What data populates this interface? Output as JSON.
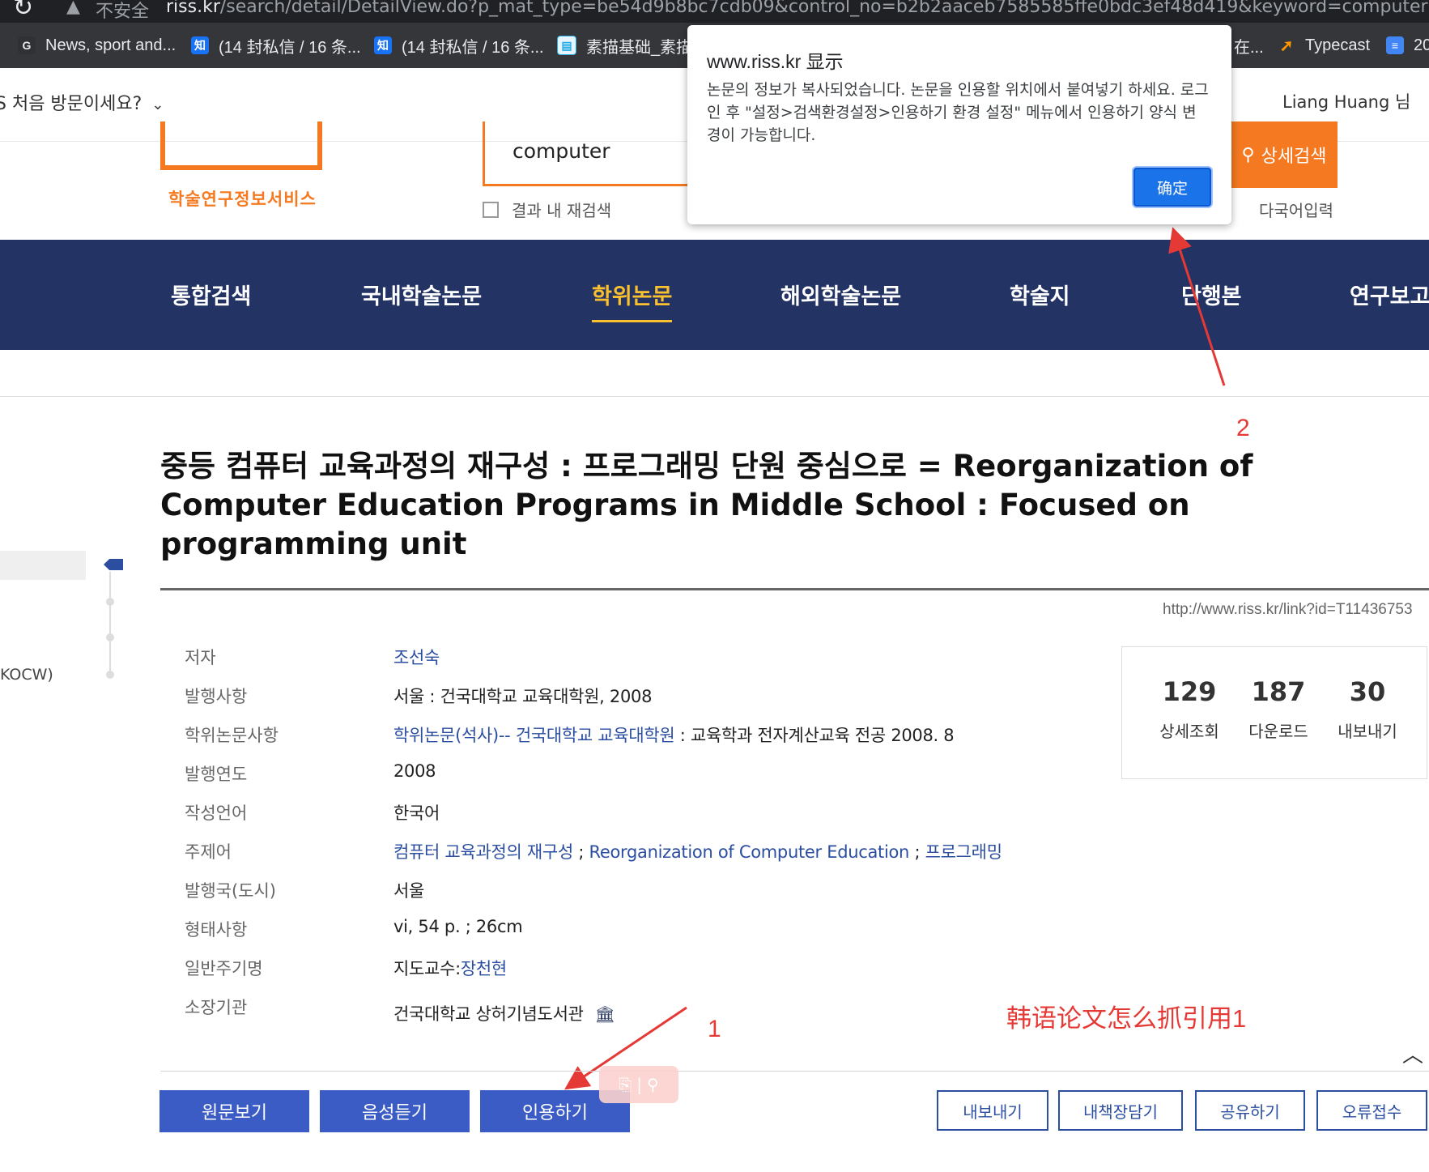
{
  "browser": {
    "security_label": "不安全",
    "url_domain": "riss.kr",
    "url_path": "/search/detail/DetailView.do?p_mat_type=be54d9b8bc7cdb09&control_no=b2b2aaceb7585585ffe0bdc3ef48d419&keyword=computer",
    "bookmarks": [
      {
        "label": "News, sport and...",
        "icon": "google-news-icon"
      },
      {
        "label": "(14 封私信 / 16 条...",
        "icon": "zhihu-icon"
      },
      {
        "label": "(14 封私信 / 16 条...",
        "icon": "zhihu-icon"
      },
      {
        "label": "素描基础_素描入",
        "icon": "bilibili-icon"
      },
      {
        "label": "在...",
        "icon": "page-icon"
      },
      {
        "label": "Typecast",
        "icon": "typecast-icon"
      },
      {
        "label": "20",
        "icon": "folder-icon"
      }
    ]
  },
  "header": {
    "first_visit": "S 처음 방문이세요?",
    "user_greeting": "Liang Huang 님",
    "logo_subtitle": "학술연구정보서비스",
    "search_value": "computer",
    "research_within_label": "결과 내 재검색",
    "advanced_search_label": "상세검색",
    "multilang_label": "다국어입력"
  },
  "nav": {
    "items": [
      "통합검색",
      "국내학술논문",
      "학위논문",
      "해외학술논문",
      "학술지",
      "단행본",
      "연구보고서"
    ],
    "active": "학위논문"
  },
  "left_panel": {
    "ocw_label": "KOCW)"
  },
  "record": {
    "title": "중등 컴퓨터 교육과정의 재구성 : 프로그래밍 단원 중심으로 = Reorganization of Computer Education Programs in Middle School : Focused on programming unit",
    "permalink": "http://www.riss.kr/link?id=T11436753",
    "fields": {
      "author_label": "저자",
      "author": "조선숙",
      "publisher_label": "발행사항",
      "publisher": "서울 : 건국대학교 교육대학원, 2008",
      "degree_label": "학위논문사항",
      "degree_link": "학위논문(석사)-- 건국대학교 교육대학원",
      "degree_rest": " : 교육학과 전자계산교육 전공 2008. 8",
      "year_label": "발행연도",
      "year": "2008",
      "language_label": "작성언어",
      "language": "한국어",
      "subject_label": "주제어",
      "subject_1": "컴퓨터 교육과정의 재구성",
      "subject_2": "Reorganization of Computer Education",
      "subject_3": "프로그래밍",
      "subject_sep": " ; ",
      "country_label": "발행국(도시)",
      "country": "서울",
      "form_label": "형태사항",
      "form": "vi, 54 p. ; 26cm",
      "note_label": "일반주기명",
      "note_prefix": "지도교수:",
      "note_link": "장천현",
      "holding_label": "소장기관",
      "holding": "건국대학교 상허기념도서관"
    }
  },
  "stats": [
    {
      "value": "129",
      "label": "상세조회"
    },
    {
      "value": "187",
      "label": "다운로드"
    },
    {
      "value": "30",
      "label": "내보내기"
    }
  ],
  "actions": {
    "view_original": "원문보기",
    "listen": "음성듣기",
    "cite": "인용하기",
    "export": "내보내기",
    "bookshelf": "내책장담기",
    "share": "공유하기",
    "report_error": "오류접수"
  },
  "annotations": {
    "step1": "1",
    "step2": "2",
    "caption": "韩语论文怎么抓引用1"
  },
  "dialog": {
    "title": "www.riss.kr 显示",
    "message": "논문의 정보가 복사되었습니다. 논문을 인용할 위치에서 붙여넣기 하세요. 로그인 후 \"설정>검색환경설정>인용하기 환경 설정\" 메뉴에서 인용하기 양식 변경이 가능합니다.",
    "ok_label": "确定"
  },
  "colors": {
    "nav_bg": "#233464",
    "nav_active": "#fbc02d",
    "brand_orange": "#f47920",
    "button_blue": "#3b5cc4",
    "link_blue": "#2b4ea1",
    "annotation_red": "#e53935",
    "dialog_ok": "#1a73e8"
  }
}
